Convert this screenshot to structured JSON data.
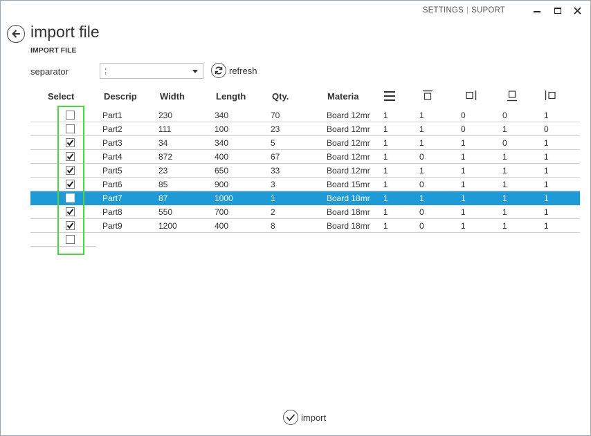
{
  "titlebar": {
    "settings_label": "SETTINGS",
    "separator": "|",
    "support_label": "SUPORT"
  },
  "header": {
    "title": "import file",
    "subtitle": "IMPORT FILE"
  },
  "separator_field": {
    "label": "separator",
    "value": ";"
  },
  "refresh_label": "refresh",
  "import_label": "import",
  "columns": {
    "select": "Select",
    "descrip": "Descrip",
    "width": "Width",
    "length": "Length",
    "qty": "Qty.",
    "material": "Materia"
  },
  "edge_icons": [
    "grain-lines-icon",
    "edge-top-icon",
    "edge-right-icon",
    "edge-bottom-icon",
    "edge-left-icon"
  ],
  "rows": [
    {
      "checked": false,
      "descrip": "Part1",
      "width": "230",
      "length": "340",
      "qty": "70",
      "material": "Board 12mr",
      "e1": "1",
      "e2": "1",
      "e3": "0",
      "e4": "0",
      "e5": "1"
    },
    {
      "checked": false,
      "descrip": "Part2",
      "width": "111",
      "length": "100",
      "qty": "23",
      "material": "Board 12mr",
      "e1": "1",
      "e2": "1",
      "e3": "0",
      "e4": "1",
      "e5": "0"
    },
    {
      "checked": true,
      "descrip": "Part3",
      "width": "34",
      "length": "340",
      "qty": "5",
      "material": "Board 12mr",
      "e1": "1",
      "e2": "1",
      "e3": "1",
      "e4": "0",
      "e5": "1"
    },
    {
      "checked": true,
      "descrip": "Part4",
      "width": "872",
      "length": "400",
      "qty": "67",
      "material": "Board 12mr",
      "e1": "1",
      "e2": "0",
      "e3": "1",
      "e4": "1",
      "e5": "1"
    },
    {
      "checked": true,
      "descrip": "Part5",
      "width": "23",
      "length": "650",
      "qty": "33",
      "material": "Board 12mr",
      "e1": "1",
      "e2": "1",
      "e3": "1",
      "e4": "1",
      "e5": "1"
    },
    {
      "checked": true,
      "descrip": "Part6",
      "width": "85",
      "length": "900",
      "qty": "3",
      "material": "Board 15mr",
      "e1": "1",
      "e2": "0",
      "e3": "1",
      "e4": "1",
      "e5": "1"
    },
    {
      "checked": false,
      "selected": true,
      "descrip": "Part7",
      "width": "87",
      "length": "1000",
      "qty": "1",
      "material": "Board 18mr",
      "e1": "1",
      "e2": "1",
      "e3": "1",
      "e4": "1",
      "e5": "1"
    },
    {
      "checked": true,
      "descrip": "Part8",
      "width": "550",
      "length": "700",
      "qty": "2",
      "material": "Board 18mr",
      "e1": "1",
      "e2": "0",
      "e3": "1",
      "e4": "1",
      "e5": "1"
    },
    {
      "checked": true,
      "descrip": "Part9",
      "width": "1200",
      "length": "400",
      "qty": "8",
      "material": "Board 18mr",
      "e1": "1",
      "e2": "0",
      "e3": "1",
      "e4": "1",
      "e5": "1"
    },
    {
      "checked": false,
      "descrip": "",
      "width": "",
      "length": "",
      "qty": "",
      "material": "",
      "e1": "",
      "e2": "",
      "e3": "",
      "e4": "",
      "e5": ""
    }
  ],
  "colors": {
    "selection": "#1e9ad6",
    "highlight_box": "#4cd640"
  }
}
